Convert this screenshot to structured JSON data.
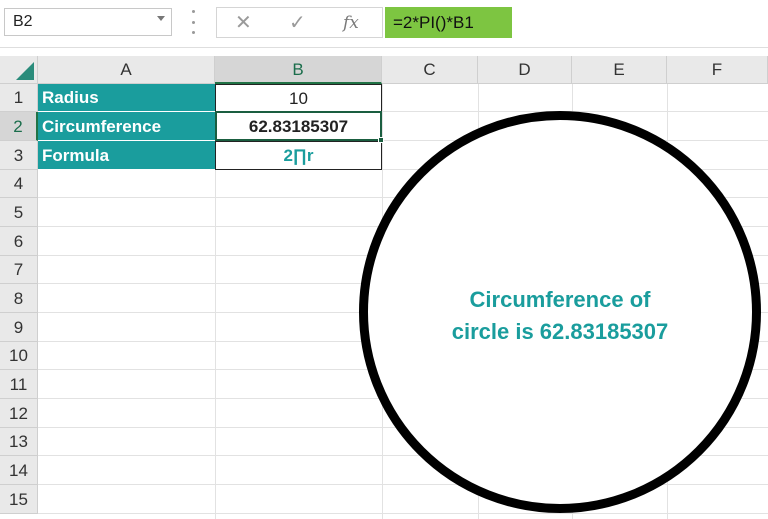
{
  "formula_bar": {
    "name_box": "B2",
    "formula": "=2*PI()*B1",
    "cancel_glyph": "✕",
    "enter_glyph": "✓",
    "fx_label": "fx"
  },
  "columns": [
    "A",
    "B",
    "C",
    "D",
    "E",
    "F"
  ],
  "rows": [
    "1",
    "2",
    "3",
    "4",
    "5",
    "6",
    "7",
    "8",
    "9",
    "10",
    "11",
    "12",
    "13",
    "14",
    "15"
  ],
  "cells": {
    "A1": "Radius",
    "B1": "10",
    "A2": "Circumference",
    "B2": "62.83185307",
    "A3": "Formula",
    "B3": "2∏r"
  },
  "shape": {
    "type": "circle",
    "line1": "Circumference of",
    "line2": "circle is 62.83185307"
  },
  "colors": {
    "accent_teal": "#1a9d9d",
    "formula_highlight": "#7dc541",
    "selection_green": "#217346"
  },
  "icons": {
    "corner": "select-all-triangle-icon",
    "name_box_dropdown": "chevron-down-icon"
  }
}
